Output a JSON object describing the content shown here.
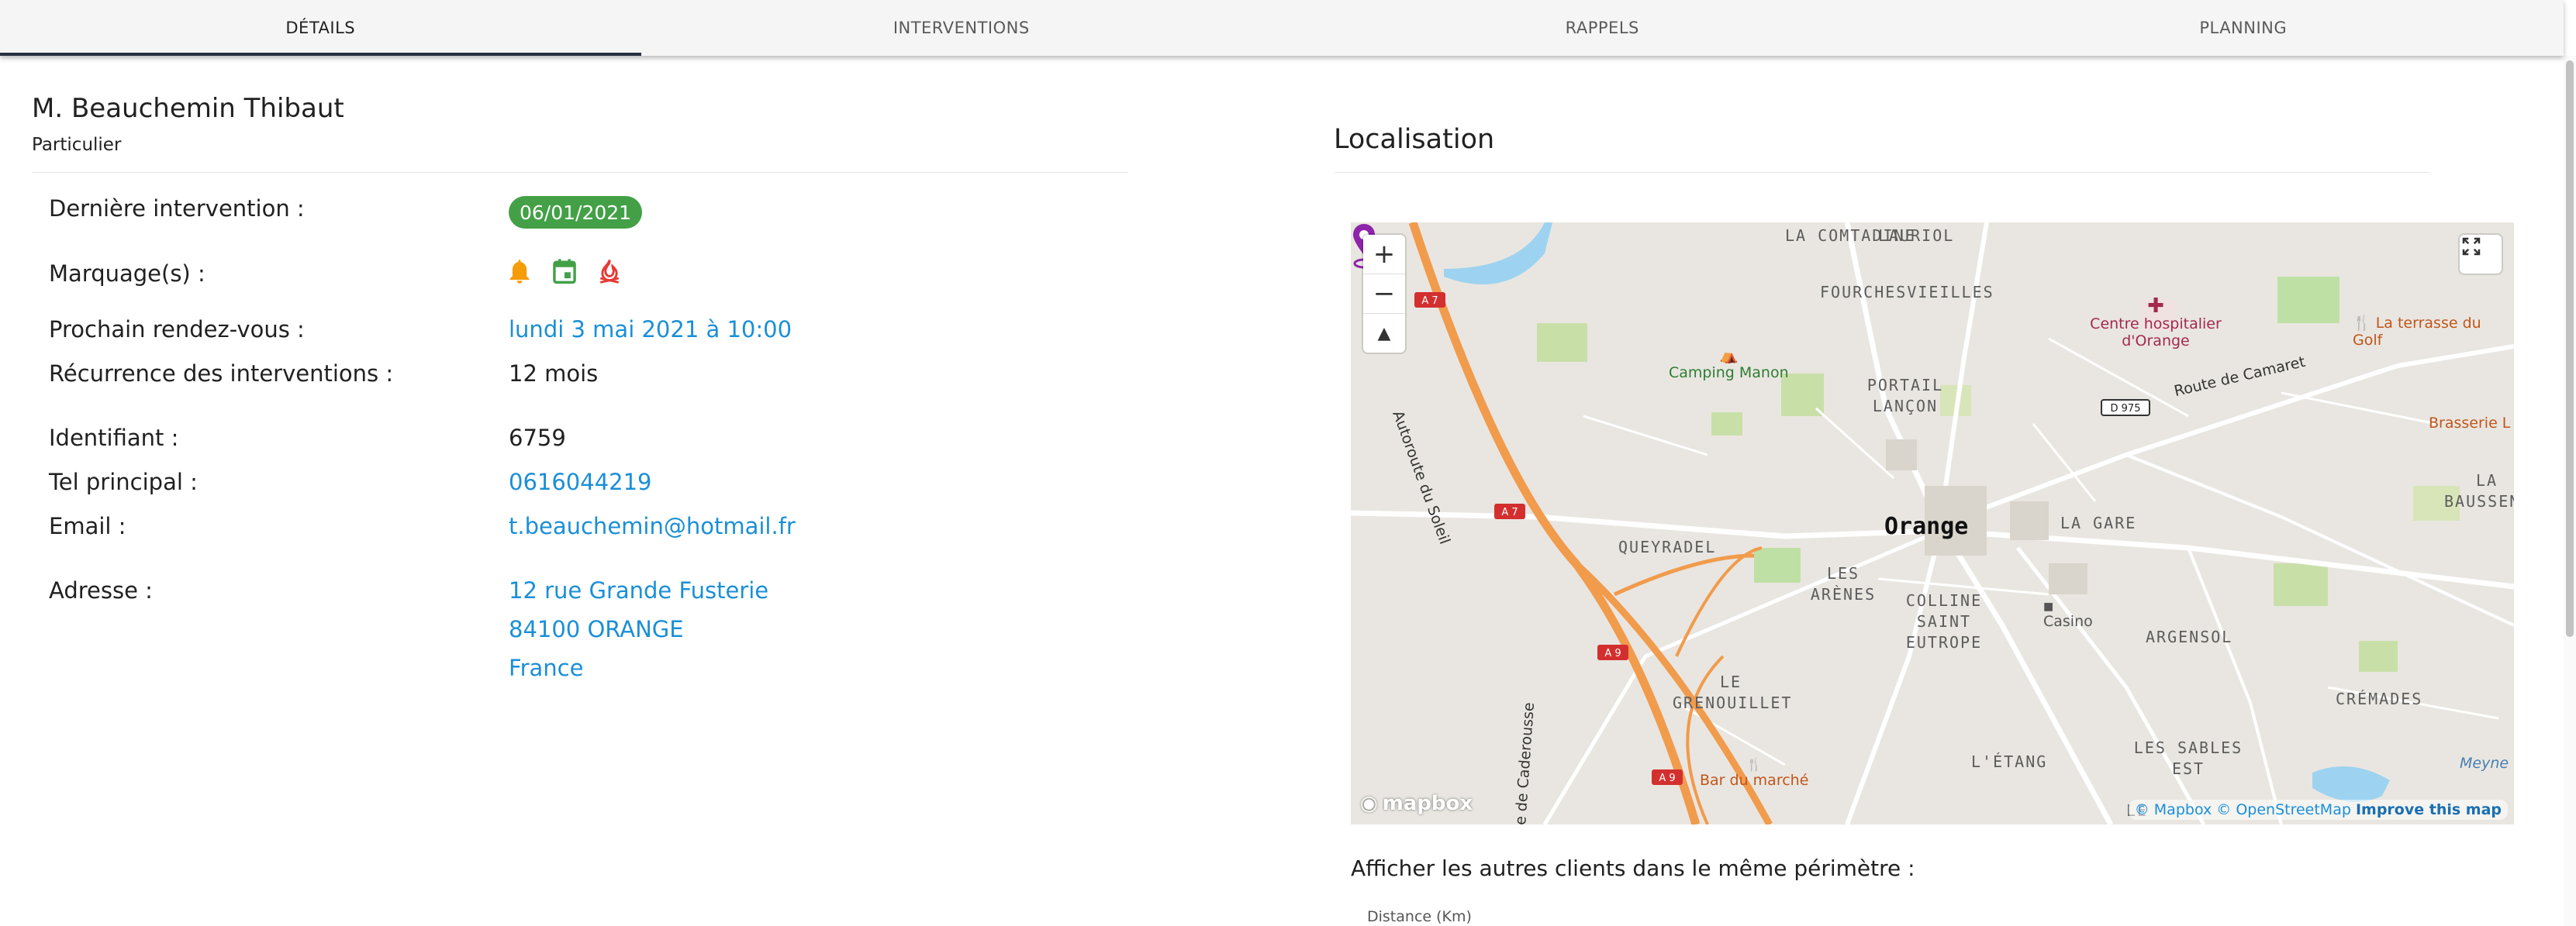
{
  "tabs": [
    {
      "label": "DÉTAILS",
      "active": true
    },
    {
      "label": "INTERVENTIONS",
      "active": false
    },
    {
      "label": "RAPPELS",
      "active": false
    },
    {
      "label": "PLANNING",
      "active": false
    }
  ],
  "client": {
    "name": "M. Beauchemin Thibaut",
    "type": "Particulier"
  },
  "fields": {
    "last_intervention_label": "Dernière intervention :",
    "last_intervention_value": "06/01/2021",
    "markings_label": "Marquage(s) :",
    "markings": [
      {
        "icon": "bell-icon",
        "color": "#f59c0b"
      },
      {
        "icon": "calendar-icon",
        "color": "#43a047"
      },
      {
        "icon": "fire-icon",
        "color": "#e53935"
      }
    ],
    "next_appointment_label": "Prochain rendez-vous :",
    "next_appointment_value": "lundi 3 mai 2021 à 10:00",
    "recurrence_label": "Récurrence des interventions :",
    "recurrence_value": "12 mois",
    "identifier_label": "Identifiant :",
    "identifier_value": "6759",
    "phone_label": "Tel principal :",
    "phone_value": "0616044219",
    "email_label": "Email :",
    "email_value": "t.beauchemin@hotmail.fr",
    "address_label": "Adresse :",
    "address_line1": "12 rue Grande Fusterie",
    "address_line2": "84100 ORANGE",
    "address_line3": "France"
  },
  "location": {
    "title": "Localisation",
    "map": {
      "zoom_in": "+",
      "zoom_out": "−",
      "compass": "▲",
      "city_label": "Orange",
      "districts": [
        "LA COMTADINE",
        "LAURIOL",
        "FOURCHESVIEILLES",
        "PORTAIL LANÇON",
        "QUEYRADEL",
        "LES ARÈNES",
        "COLLINE SAINT EUTROPE",
        "LA GARE",
        "LA BAUSSENQUE",
        "ARGENSOL",
        "CRÉMADES",
        "LE GRENOUILLET",
        "L'ÉTANG",
        "LES SABLES EST",
        "LE"
      ],
      "pois": [
        "Camping Manon",
        "Centre hospitalier d'Orange",
        "La terrasse du Golf",
        "Brasserie L",
        "Casino",
        "Bar du marché",
        "Meyne"
      ],
      "roads": [
        "Autoroute du Soleil",
        "Route de Camaret",
        "e de Caderousse"
      ],
      "shields": [
        "A 7",
        "A 7",
        "A 9",
        "A 9",
        "D 975"
      ],
      "logo": "mapbox",
      "attribution_mapbox": "© Mapbox",
      "attribution_osm": "© OpenStreetMap",
      "attribution_improve": "Improve this map"
    }
  },
  "nearby": {
    "title": "Afficher les autres clients dans le même périmètre :",
    "distance_label": "Distance (Km)"
  },
  "colors": {
    "accent_link": "#1a8fd8",
    "badge_green": "#43a047",
    "tab_indicator": "#263140"
  }
}
